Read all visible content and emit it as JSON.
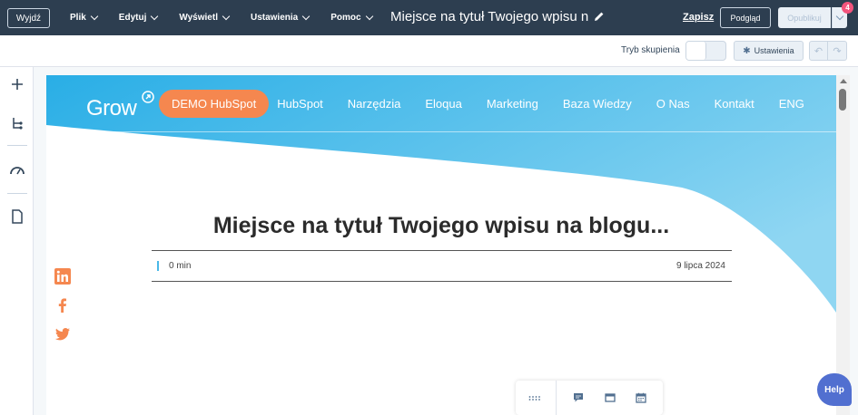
{
  "topbar": {
    "exit_label": "Wyjdź",
    "menu": [
      {
        "label": "Plik"
      },
      {
        "label": "Edytuj"
      },
      {
        "label": "Wyświetl"
      },
      {
        "label": "Ustawienia"
      },
      {
        "label": "Pomoc"
      }
    ],
    "doc_title": "Miejsce na tytuł Twojego wpisu na blogu...",
    "save_label": "Zapisz",
    "preview_label": "Podgląd",
    "publish_label": "Opublikuj",
    "notification_count": "4"
  },
  "subbar": {
    "focus_mode_label": "Tryb skupienia",
    "settings_label": "Ustawienia"
  },
  "site": {
    "logo_text": "Grow",
    "nav": [
      {
        "label": "DEMO HubSpot"
      },
      {
        "label": "HubSpot"
      },
      {
        "label": "Narzędzia"
      },
      {
        "label": "Eloqua"
      },
      {
        "label": "Marketing"
      },
      {
        "label": "Baza Wiedzy"
      },
      {
        "label": "O Nas"
      },
      {
        "label": "Kontakt"
      },
      {
        "label": "ENG"
      }
    ]
  },
  "post": {
    "title": "Miejsce na tytuł Twojego wpisu na blogu...",
    "read_time": "0 min",
    "date": "9 lipca 2024"
  },
  "help_label": "Help",
  "colors": {
    "topbar": "#2d3e50",
    "hero_start": "#29aee6",
    "hero_end": "#8fd6f2",
    "demo_button": "#f5874f",
    "social": "#f5874f",
    "help": "#516fd0",
    "badge": "#f2547d"
  }
}
